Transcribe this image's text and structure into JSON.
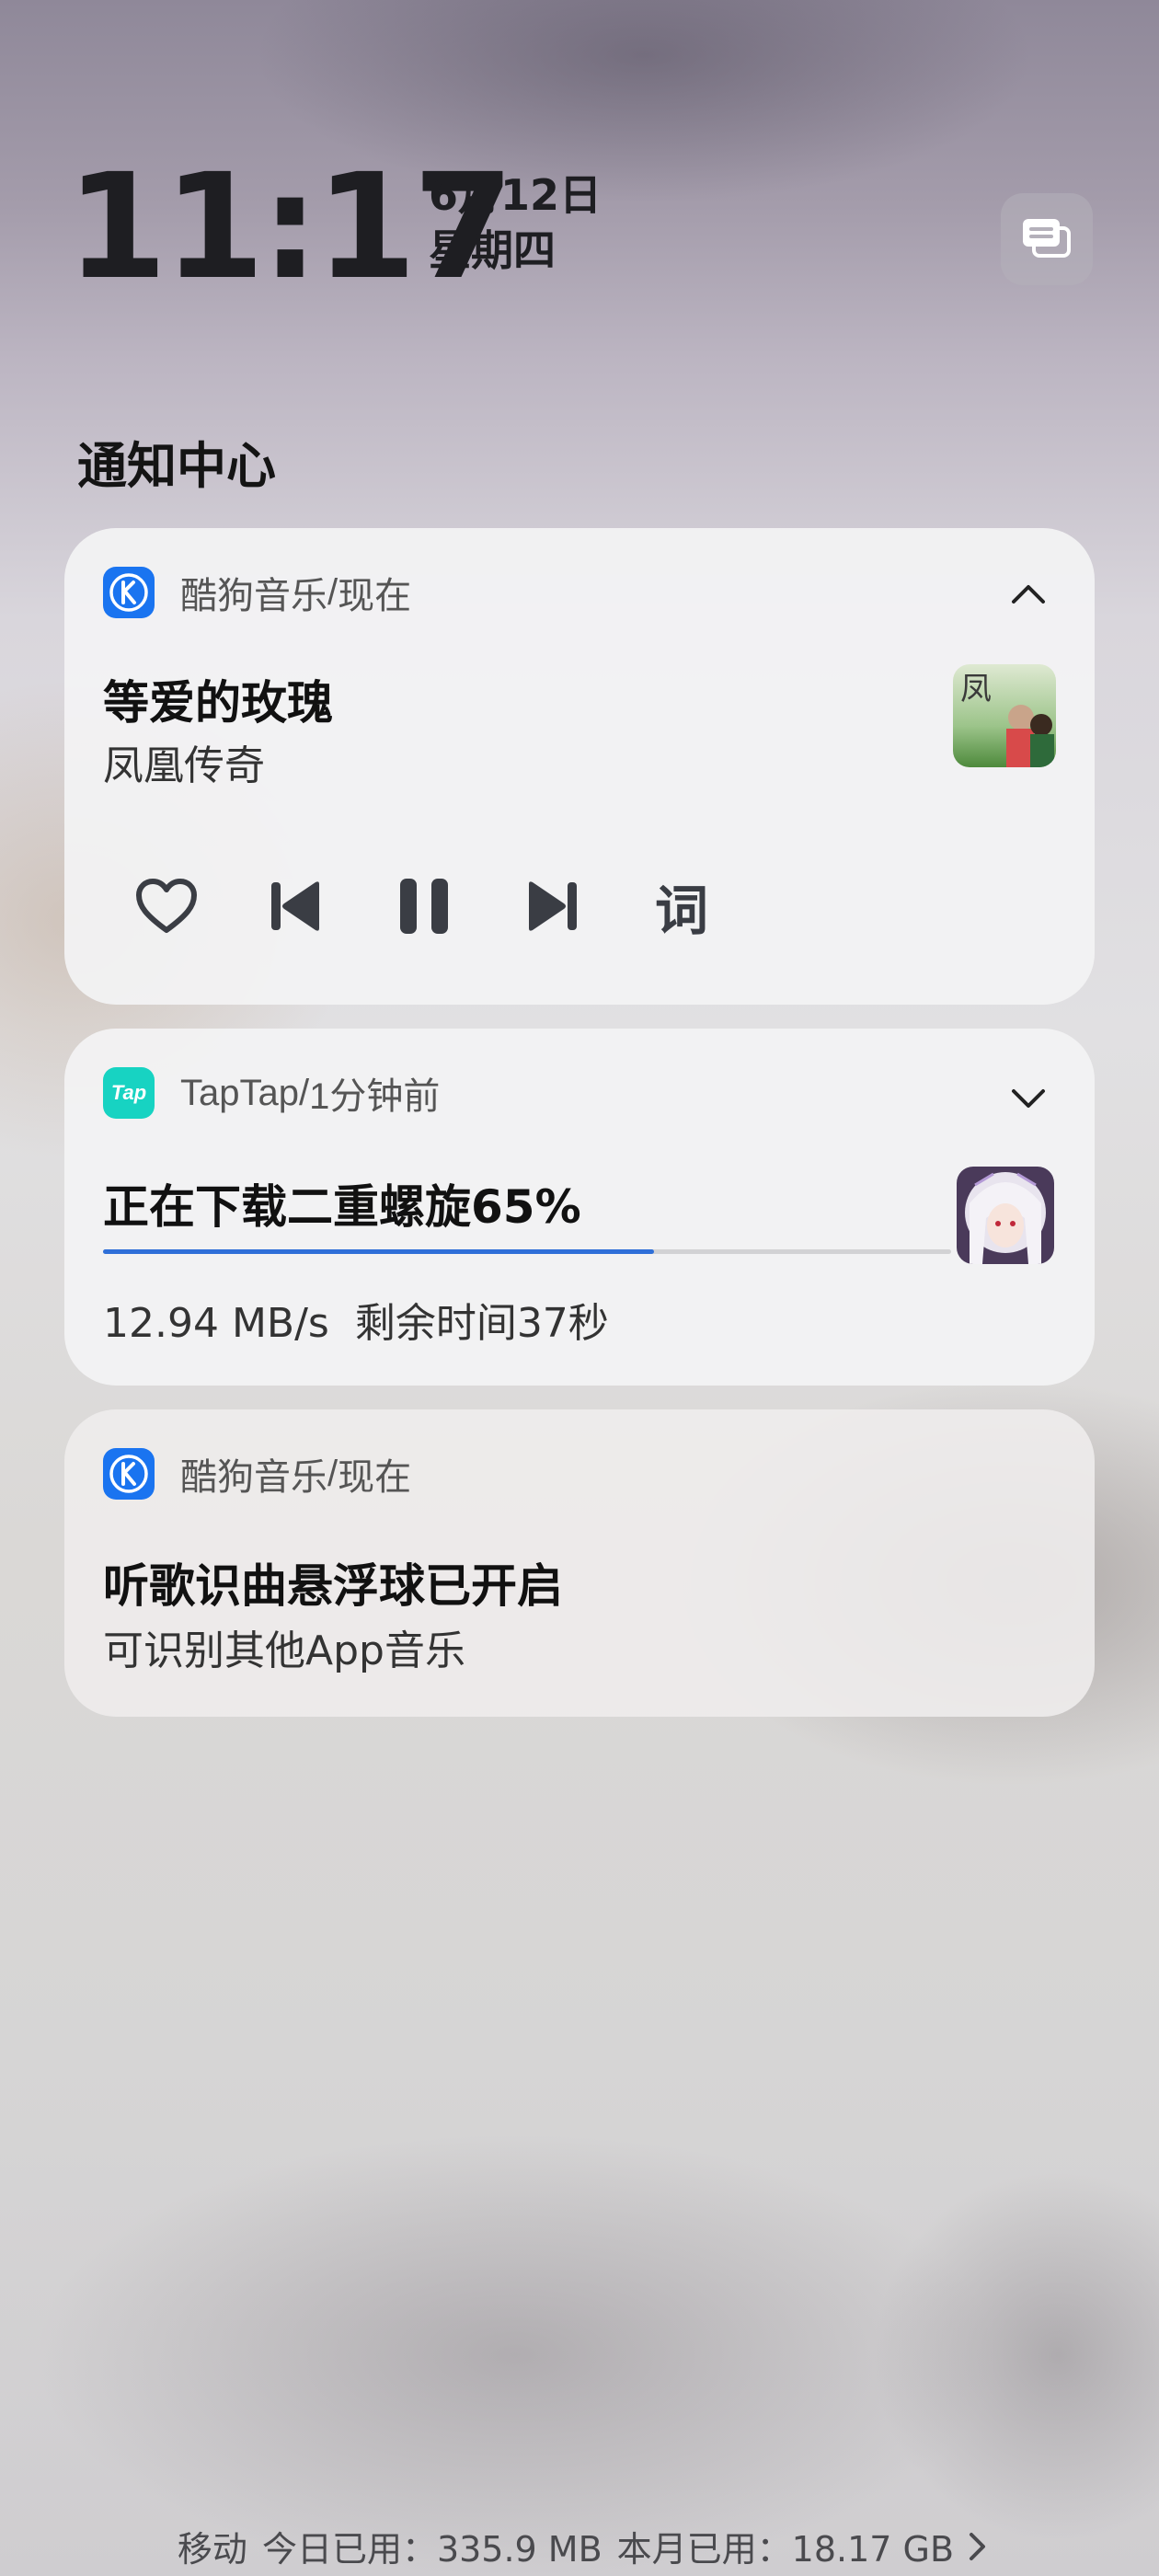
{
  "header": {
    "time": "11:17",
    "date": "6月12日",
    "weekday": "星期四",
    "section_title": "通知中心"
  },
  "notifications": [
    {
      "app": "酷狗音乐",
      "when": "现在",
      "expanded": true,
      "title": "等爱的玫瑰",
      "subtitle": "凤凰传奇",
      "controls": [
        "heart-icon",
        "previous-icon",
        "pause-icon",
        "next-icon"
      ],
      "lyric_label": "词",
      "art_text": "凤凰传奇"
    },
    {
      "app": "TapTap",
      "when": "1分钟前",
      "expanded": false,
      "app_icon_text": "Tap",
      "title": "正在下载二重螺旋65%",
      "progress": 0.65,
      "detail": "12.94 MB/s  剩余时间37秒"
    },
    {
      "app": "酷狗音乐",
      "when": "现在",
      "title": "听歌识曲悬浮球已开启",
      "subtitle": "可识别其他App音乐"
    }
  ],
  "footer": {
    "carrier": "移动",
    "today": "今日已用：335.9 MB",
    "month": "本月已用：18.17 GB"
  },
  "colors": {
    "kugou_blue": "#1a74f0",
    "taptap_teal": "#17d3c2",
    "progress_blue": "#2f6fd8"
  }
}
